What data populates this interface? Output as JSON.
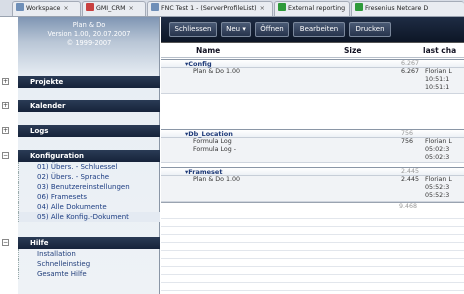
{
  "browser_tabs": [
    {
      "label": "Workspace",
      "color": "#6f8fb8"
    },
    {
      "label": "GMI_CRM",
      "color": "#c84040"
    },
    {
      "label": "FNC Test 1 - (ServerProfileList)",
      "color": "#6f8fb8"
    },
    {
      "label": "External reporting",
      "color": "#2e9a3a"
    },
    {
      "label": "Fresenius Netcare D",
      "color": "#2e9a3a"
    }
  ],
  "tab_close": "×",
  "app": {
    "name": "Plan & Do",
    "version": "Version 1.00, 20.07.2007",
    "copyright": "© 1999-2007"
  },
  "sidebar": {
    "projekte": "Projekte",
    "kalender": "Kalender",
    "logs": "Logs",
    "konfiguration": {
      "label": "Konfiguration",
      "items": [
        "01) Übers. - Schluessel",
        "02) Übers. - Sprache",
        "03) Benutzereinstellungen",
        "06) Framesets",
        "04) Alle Dokumente",
        "05) Alle Konfig.-Dokument"
      ]
    },
    "hilfe": {
      "label": "Hilfe",
      "items": [
        "Installation",
        "Schnelleinstieg",
        "Gesamte Hilfe"
      ]
    },
    "expand": "+",
    "collapse": "−"
  },
  "toolbar": {
    "close": "Schliessen",
    "new": "Neu ▾",
    "open": "Öffnen",
    "edit": "Bearbeiten",
    "print": "Drucken"
  },
  "columns": {
    "name": "Name",
    "size": "Size",
    "last": "last cha"
  },
  "groups": [
    {
      "name": "▾Config",
      "size": "6.267",
      "rows": [
        {
          "name": "Plan & Do 1.00",
          "size": "6.267",
          "last": [
            "Florian L",
            "10:51:1",
            "10:51:1"
          ]
        }
      ]
    },
    {
      "name": "▾Db_Location",
      "size": "756",
      "rows": [
        {
          "name": "Formula Log",
          "size": "756",
          "last": [
            "Florian L",
            "05:02:3",
            "05:02:3"
          ]
        },
        {
          "name": "Formula Log -",
          "size": "",
          "last": []
        }
      ]
    },
    {
      "name": "▾Frameset",
      "size": "2.445",
      "rows": [
        {
          "name": "Plan & Do 1.00",
          "size": "2.445",
          "last": [
            "Florian L",
            "05:52:3",
            "05:52:3"
          ]
        }
      ]
    }
  ],
  "total": "9.468"
}
